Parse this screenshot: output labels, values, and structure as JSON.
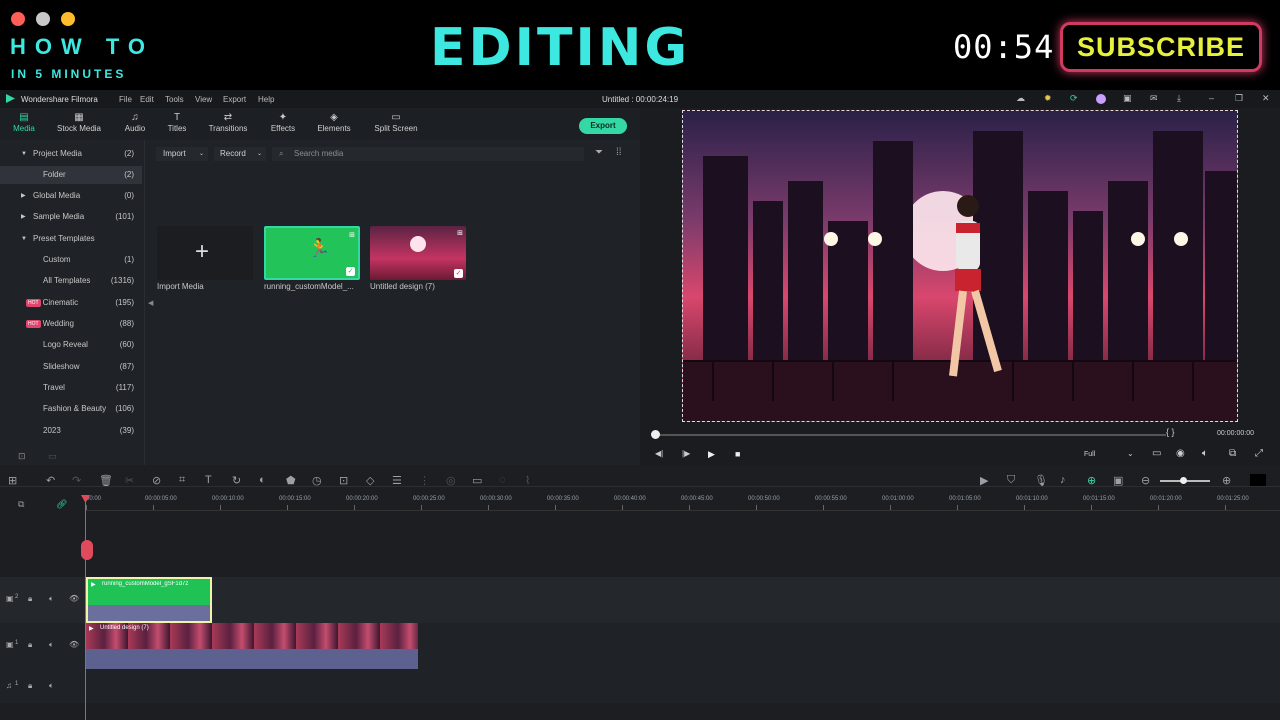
{
  "banner": {
    "how_to": "HOW TO",
    "in_5_minutes": "IN 5 MINUTES",
    "title": "EDITING",
    "timer": "00:54",
    "subscribe": "SUBSCRIBE",
    "dot_colors": [
      "#ff5f57",
      "#c8c8c8",
      "#ffbd2e"
    ]
  },
  "app": {
    "name": "Wondershare Filmora",
    "menus": [
      "File",
      "Edit",
      "Tools",
      "View",
      "Export",
      "Help"
    ],
    "project_title": "Untitled : 00:00:24:19",
    "tabs": [
      "Media",
      "Stock Media",
      "Audio",
      "Titles",
      "Transitions",
      "Effects",
      "Elements",
      "Split Screen"
    ],
    "export_label": "Export",
    "accent": "#33d8a5"
  },
  "sidebar": {
    "items": [
      {
        "label": "Project Media",
        "count": "(2)"
      },
      {
        "label": "Folder",
        "count": "(2)"
      },
      {
        "label": "Global Media",
        "count": "(0)"
      },
      {
        "label": "Sample Media",
        "count": "(101)"
      },
      {
        "label": "Preset Templates",
        "count": ""
      },
      {
        "label": "Custom",
        "count": "(1)"
      },
      {
        "label": "All Templates",
        "count": "(1316)"
      },
      {
        "label": "Cinematic",
        "count": "(195)"
      },
      {
        "label": "Wedding",
        "count": "(88)"
      },
      {
        "label": "Logo Reveal",
        "count": "(60)"
      },
      {
        "label": "Slideshow",
        "count": "(87)"
      },
      {
        "label": "Travel",
        "count": "(117)"
      },
      {
        "label": "Fashion & Beauty",
        "count": "(106)"
      },
      {
        "label": "2023",
        "count": "(39)"
      }
    ],
    "hot_badge": "HOT"
  },
  "media": {
    "import_label": "Import",
    "record_label": "Record",
    "search_placeholder": "Search media",
    "items": [
      "Import Media",
      "running_customModel_...",
      "Untitled design (7)"
    ]
  },
  "preview": {
    "timecode": "00:00:00:00",
    "quality": "Full",
    "brackets": "{      }"
  },
  "timeline": {
    "ticks": [
      "00:00",
      "00:00:05:00",
      "00:00:10:00",
      "00:00:15:00",
      "00:00:20:00",
      "00:00:25:00",
      "00:00:30:00",
      "00:00:35:00",
      "00:00:40:00",
      "00:00:45:00",
      "00:00:50:00",
      "00:00:55:00",
      "00:01:00:00",
      "00:01:05:00",
      "00:01:10:00",
      "00:01:15:00",
      "00:01:20:00",
      "00:01:25:00"
    ],
    "clip_green": "running_customModel_gSF1d7z",
    "clip_city": "Untitled design (7)",
    "track_labels": [
      "2",
      "1",
      "1"
    ]
  }
}
